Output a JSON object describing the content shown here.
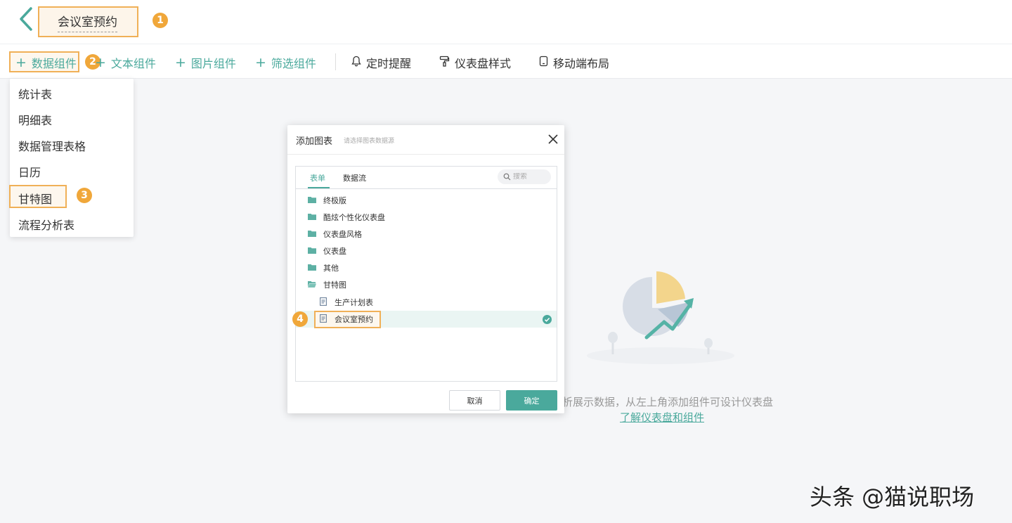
{
  "header": {
    "title": "会议室预约"
  },
  "annotations": {
    "step1": "1",
    "step2": "2",
    "step3": "3",
    "step4": "4"
  },
  "toolbar": {
    "data_widget": "数据组件",
    "text_widget": "文本组件",
    "image_widget": "图片组件",
    "filter_widget": "筛选组件",
    "scheduled_reminder": "定时提醒",
    "dashboard_style": "仪表盘样式",
    "mobile_layout": "移动端布局"
  },
  "dropdown": {
    "items": [
      "统计表",
      "明细表",
      "数据管理表格",
      "日历",
      "甘特图",
      "流程分析表"
    ]
  },
  "dialog": {
    "title": "添加图表",
    "subtitle": "请选择图表数据源",
    "tabs": [
      "表单",
      "数据流"
    ],
    "active_tab": "表单",
    "search_placeholder": "搜索",
    "tree": [
      {
        "type": "folder",
        "label": "终极版"
      },
      {
        "type": "folder",
        "label": "酷炫个性化仪表盘"
      },
      {
        "type": "folder",
        "label": "仪表盘风格"
      },
      {
        "type": "folder",
        "label": "仪表盘"
      },
      {
        "type": "folder",
        "label": "其他"
      },
      {
        "type": "folder-open",
        "label": "甘特图"
      },
      {
        "type": "file",
        "label": "生产计划表"
      },
      {
        "type": "file",
        "label": "会议室预约",
        "selected": true
      }
    ],
    "cancel_label": "取消",
    "ok_label": "确定"
  },
  "empty_state": {
    "text": "来分析展示数据，从左上角添加组件可设计仪表盘",
    "link": "了解仪表盘和组件"
  },
  "watermark": "头条 @猫说职场",
  "colors": {
    "accent": "#4aa99c",
    "highlight": "#f0b057",
    "badge": "#f0a73a"
  }
}
